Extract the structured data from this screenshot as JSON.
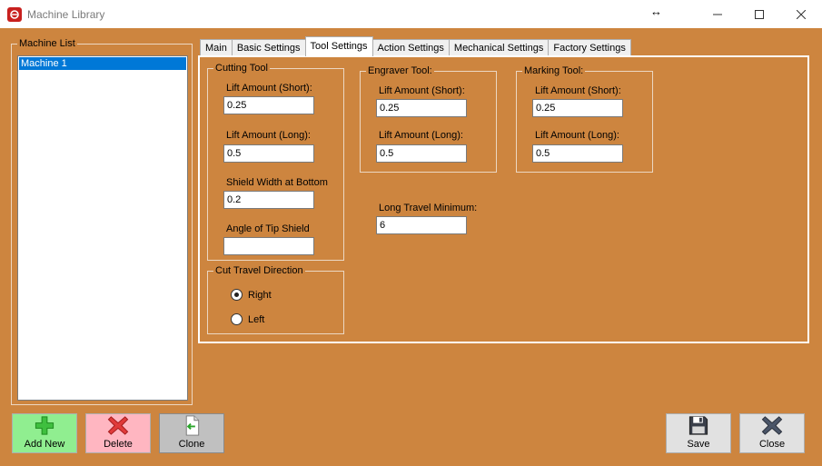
{
  "window": {
    "title": "Machine Library"
  },
  "machine_list": {
    "label": "Machine List",
    "items": [
      "Machine 1"
    ],
    "selected_index": 0
  },
  "tabs": [
    {
      "label": "Main",
      "active": false
    },
    {
      "label": "Basic Settings",
      "active": false
    },
    {
      "label": "Tool Settings",
      "active": true
    },
    {
      "label": "Action Settings",
      "active": false
    },
    {
      "label": "Mechanical Settings",
      "active": false
    },
    {
      "label": "Factory Settings",
      "active": false
    }
  ],
  "cutting_tool": {
    "label": "Cutting Tool",
    "lift_short_label": "Lift Amount (Short):",
    "lift_short_value": "0.25",
    "lift_long_label": "Lift Amount (Long):",
    "lift_long_value": "0.5",
    "shield_width_label": "Shield Width at Bottom",
    "shield_width_value": "0.2",
    "angle_tip_label": "Angle of Tip Shield",
    "angle_tip_value": ""
  },
  "engraver_tool": {
    "label": "Engraver Tool:",
    "lift_short_label": "Lift Amount (Short):",
    "lift_short_value": "0.25",
    "lift_long_label": "Lift Amount (Long):",
    "lift_long_value": "0.5"
  },
  "marking_tool": {
    "label": "Marking Tool:",
    "lift_short_label": "Lift Amount (Short):",
    "lift_short_value": "0.25",
    "lift_long_label": "Lift Amount (Long):",
    "lift_long_value": "0.5"
  },
  "long_travel": {
    "label": "Long Travel Minimum:",
    "value": "6"
  },
  "cut_travel_direction": {
    "label": "Cut Travel Direction",
    "options": [
      "Right",
      "Left"
    ],
    "selected": "Right"
  },
  "buttons": {
    "add_new": "Add New",
    "delete": "Delete",
    "clone": "Clone",
    "save": "Save",
    "close": "Close"
  },
  "colors": {
    "background": "#cd853f",
    "selection": "#0078d7",
    "add_button": "#90ee90",
    "delete_button": "#ffb6c1",
    "clone_button": "#c0c0c0"
  }
}
